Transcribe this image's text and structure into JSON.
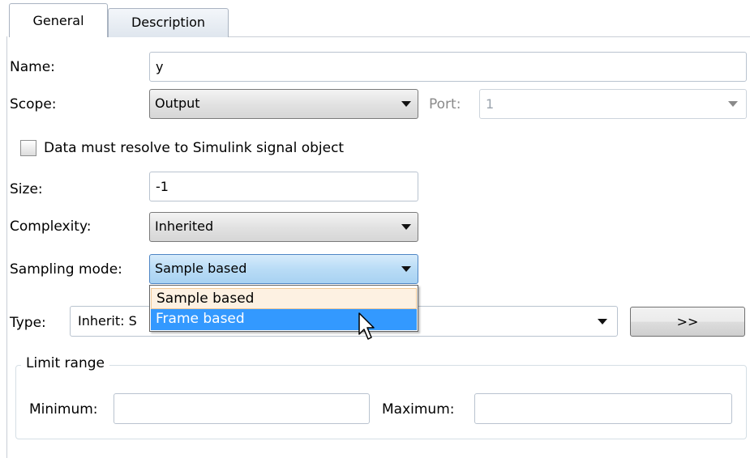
{
  "tabs": [
    {
      "label": "General",
      "active": true
    },
    {
      "label": "Description",
      "active": false
    }
  ],
  "name": {
    "label": "Name:",
    "value": "y"
  },
  "scope": {
    "label": "Scope:",
    "value": "Output",
    "port_label": "Port:",
    "port_value": "1"
  },
  "resolve_checkbox": {
    "label": "Data must resolve to Simulink signal object",
    "checked": false
  },
  "size": {
    "label": "Size:",
    "value": "-1"
  },
  "complexity": {
    "label": "Complexity:",
    "value": "Inherited"
  },
  "sampling_mode": {
    "label": "Sampling mode:",
    "value": "Sample based",
    "options": [
      "Sample based",
      "Frame based"
    ],
    "hovered_option": "Frame based"
  },
  "type": {
    "label": "Type:",
    "value_visible": "Inherit: S",
    "button_label": ">>"
  },
  "limit_range": {
    "legend": "Limit range",
    "minimum_label": "Minimum:",
    "minimum_value": "",
    "maximum_label": "Maximum:",
    "maximum_value": ""
  },
  "colors": {
    "focus_blue": "#3399ff",
    "focused_combo": "#b9dcf6"
  }
}
